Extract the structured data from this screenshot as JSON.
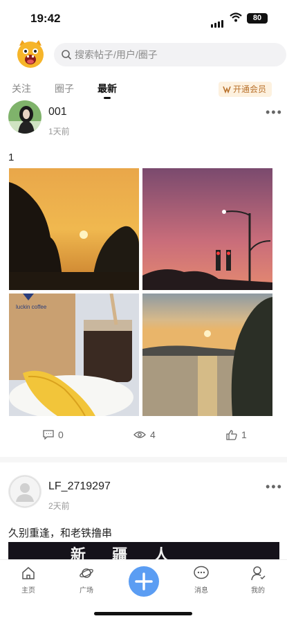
{
  "status_bar": {
    "time": "19:42",
    "battery": "80"
  },
  "search": {
    "placeholder": "搜索帖子/用户/圈子"
  },
  "tabs": [
    {
      "label": "关注",
      "active": false
    },
    {
      "label": "圈子",
      "active": false
    },
    {
      "label": "最新",
      "active": true
    }
  ],
  "vip_button": {
    "label": "开通会员"
  },
  "posts": [
    {
      "username": "001",
      "time": "1天前",
      "text": "1",
      "photos": [
        "sunset-trees",
        "pink-sky-streetlight",
        "luckin-coffee-corn",
        "lake-sunset"
      ],
      "photo_watermark": "luckin coffee",
      "stats": {
        "comments": "0",
        "views": "4",
        "likes": "1"
      }
    },
    {
      "username": "LF_2719297",
      "time": "2天前",
      "text": "久别重逢，和老铁撸串",
      "banner_text": "新  疆  人"
    }
  ],
  "bottom_nav": [
    {
      "label": "主页",
      "icon": "home-icon"
    },
    {
      "label": "广场",
      "icon": "planet-icon"
    },
    {
      "label": "",
      "icon": "plus-icon"
    },
    {
      "label": "消息",
      "icon": "chat-icon"
    },
    {
      "label": "我的",
      "icon": "profile-icon"
    }
  ],
  "colors": {
    "accent": "#5b9df3",
    "vip_text": "#b9722d",
    "vip_bg": "#fdf1df"
  }
}
